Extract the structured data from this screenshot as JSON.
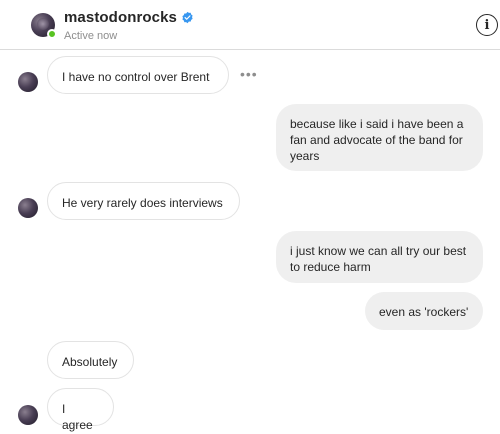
{
  "header": {
    "username": "mastodonrocks",
    "status": "Active now",
    "verified_icon": "verified-badge-icon",
    "info_icon": "info-icon",
    "info_glyph": "i"
  },
  "colors": {
    "verified": "#3897f0",
    "online": "#58c322",
    "outgoing_bubble": "#efefef",
    "incoming_border": "#e3e3e3"
  },
  "messages": [
    {
      "direction": "incoming",
      "text": "I have no control over Brent"
    },
    {
      "direction": "outgoing",
      "text": "because like i said i have been a fan and advocate of the band for years"
    },
    {
      "direction": "incoming",
      "text": "He very rarely does interviews"
    },
    {
      "direction": "outgoing",
      "text": "i just know we can all try our best to reduce harm"
    },
    {
      "direction": "outgoing",
      "text": "even as 'rockers'"
    },
    {
      "direction": "incoming",
      "text": "Absolutely"
    },
    {
      "direction": "incoming",
      "text": "I agree"
    }
  ],
  "message_options": "•••"
}
